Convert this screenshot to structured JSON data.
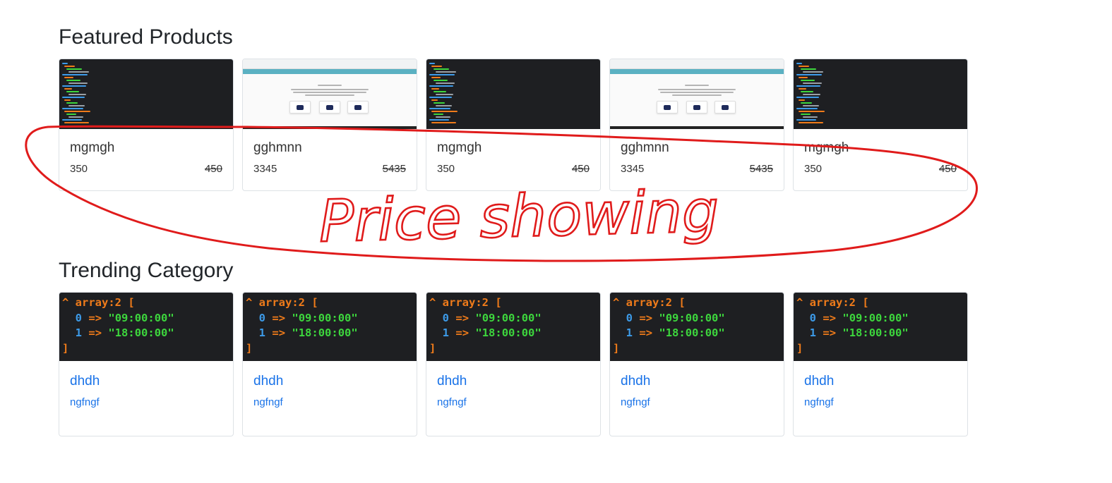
{
  "featured": {
    "title": "Featured Products",
    "products": [
      {
        "name": "mgmgh",
        "price": "350",
        "old_price": "450",
        "thumbnail": "code-screenshot"
      },
      {
        "name": "gghmnn",
        "price": "3345",
        "old_price": "5435",
        "thumbnail": "app-screenshot"
      },
      {
        "name": "mgmgh",
        "price": "350",
        "old_price": "450",
        "thumbnail": "code-screenshot"
      },
      {
        "name": "gghmnn",
        "price": "3345",
        "old_price": "5435",
        "thumbnail": "app-screenshot"
      },
      {
        "name": "mgmgh",
        "price": "350",
        "old_price": "450",
        "thumbnail": "code-screenshot"
      }
    ]
  },
  "trending": {
    "title": "Trending Category",
    "code": {
      "open": "^ array:2 [",
      "i0": "0",
      "v0": "\"09:00:00\"",
      "i1": "1",
      "v1": "\"18:00:00\"",
      "close": "]",
      "arrow": "=>"
    },
    "categories": [
      {
        "name": "dhdh",
        "sub": "ngfngf"
      },
      {
        "name": "dhdh",
        "sub": "ngfngf"
      },
      {
        "name": "dhdh",
        "sub": "ngfngf"
      },
      {
        "name": "dhdh",
        "sub": "ngfngf"
      },
      {
        "name": "dhdh",
        "sub": "ngfngf"
      }
    ]
  },
  "annotation": {
    "text": "Price showing",
    "color": "#e01b1b"
  },
  "colors": {
    "link": "#1a73e8",
    "code_bg": "#1e1f22",
    "code_orange": "#ef7b1a",
    "code_blue": "#3d9be9",
    "code_green": "#3dd63d"
  }
}
